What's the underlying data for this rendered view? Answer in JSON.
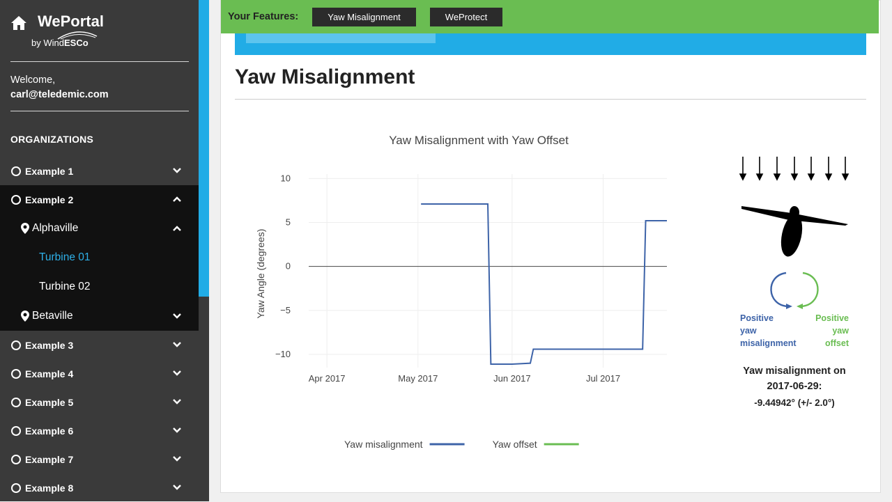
{
  "brand": {
    "title": "WePortal",
    "by": "by",
    "company_prefix": "Wind",
    "company_suffix": "ESCo"
  },
  "welcome": {
    "greeting": "Welcome,",
    "email": "carl@teledemic.com"
  },
  "sidebar": {
    "heading": "ORGANIZATIONS",
    "orgs": [
      "Example 1",
      "Example 2",
      "Example 3",
      "Example 4",
      "Example 5",
      "Example 6",
      "Example 7",
      "Example 8"
    ],
    "sites": [
      "Alphaville",
      "Betaville"
    ],
    "turbines": [
      "Turbine 01",
      "Turbine 02"
    ]
  },
  "features": {
    "label": "Your Features:",
    "buttons": [
      "Yaw Misalignment",
      "WeProtect"
    ]
  },
  "progress": {
    "fraction": 0.3
  },
  "page": {
    "title": "Yaw Misalignment"
  },
  "chart_data": {
    "type": "line",
    "title": "Yaw Misalignment with Yaw Offset",
    "xlabel": "",
    "ylabel": "Yaw Angle (degrees)",
    "ylim": [
      -11.5,
      10.5
    ],
    "yticks": [
      "10",
      "5",
      "0",
      "−5",
      "−10"
    ],
    "yticks_values": [
      10,
      5,
      0,
      -5,
      -10
    ],
    "xticks": [
      "Apr 2017",
      "May 2017",
      "Jun 2017",
      "Jul 2017"
    ],
    "xticks_dates": [
      "2017-04-01",
      "2017-05-01",
      "2017-06-01",
      "2017-07-01"
    ],
    "xlim": [
      "2017-03-26",
      "2017-07-22"
    ],
    "grid": true,
    "legend_placement": "bottom",
    "series": [
      {
        "name": "Yaw misalignment",
        "color": "#3d63a8",
        "x": [
          "2017-05-02",
          "2017-05-24",
          "2017-05-25",
          "2017-06-01",
          "2017-06-07",
          "2017-06-08",
          "2017-07-14",
          "2017-07-15",
          "2017-07-22"
        ],
        "y": [
          7.1,
          7.1,
          -11.1,
          -11.1,
          -11.0,
          -9.4,
          -9.4,
          5.2,
          5.2
        ]
      },
      {
        "name": "Yaw offset",
        "color": "#6abd52",
        "x": [],
        "y": []
      }
    ]
  },
  "diagram": {
    "positive_yaw": [
      "Positive",
      "yaw",
      "misalignment"
    ],
    "positive_offset": [
      "Positive",
      "yaw",
      "offset"
    ],
    "caption_line1": "Yaw misalignment on",
    "caption_line2": "2017-06-29:",
    "value": "-9.44942° (+/- 2.0°)",
    "colors": {
      "misalignment": "#3d63a8",
      "offset": "#6abd52"
    }
  }
}
